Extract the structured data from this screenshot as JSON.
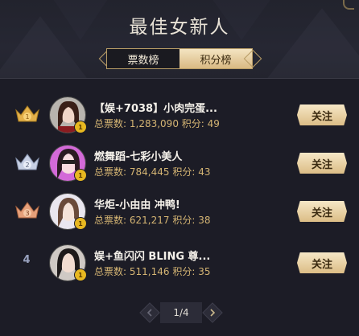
{
  "header": {
    "title": "最佳女新人",
    "tabs": [
      {
        "label": "票数榜",
        "active": true
      },
      {
        "label": "积分榜",
        "active": false
      }
    ]
  },
  "labels": {
    "votes_prefix": "总票数:",
    "score_prefix": "积分:",
    "follow": "关注"
  },
  "rows": [
    {
      "rank": "1",
      "rank_style": "gold-crown",
      "name": "【娱+7038】小肉完蛋...",
      "votes": "1,283,090",
      "score": "49",
      "level": "1"
    },
    {
      "rank": "2",
      "rank_style": "silver-crown",
      "name": "燃舞蹈-七彩小美人",
      "votes": "784,445",
      "score": "43",
      "level": "1"
    },
    {
      "rank": "3",
      "rank_style": "bronze-crown",
      "name": "华炬-小由由 冲鸭!",
      "votes": "621,217",
      "score": "38",
      "level": "1"
    },
    {
      "rank": "4",
      "rank_style": "plain",
      "name": "娱+鱼闪闪 BLING 尊...",
      "votes": "511,146",
      "score": "35",
      "level": "1"
    }
  ],
  "pager": {
    "label": "1/4"
  },
  "colors": {
    "gold": "#d4b473",
    "background": "#1c1c26",
    "follow_button": "#e9d2a4"
  }
}
